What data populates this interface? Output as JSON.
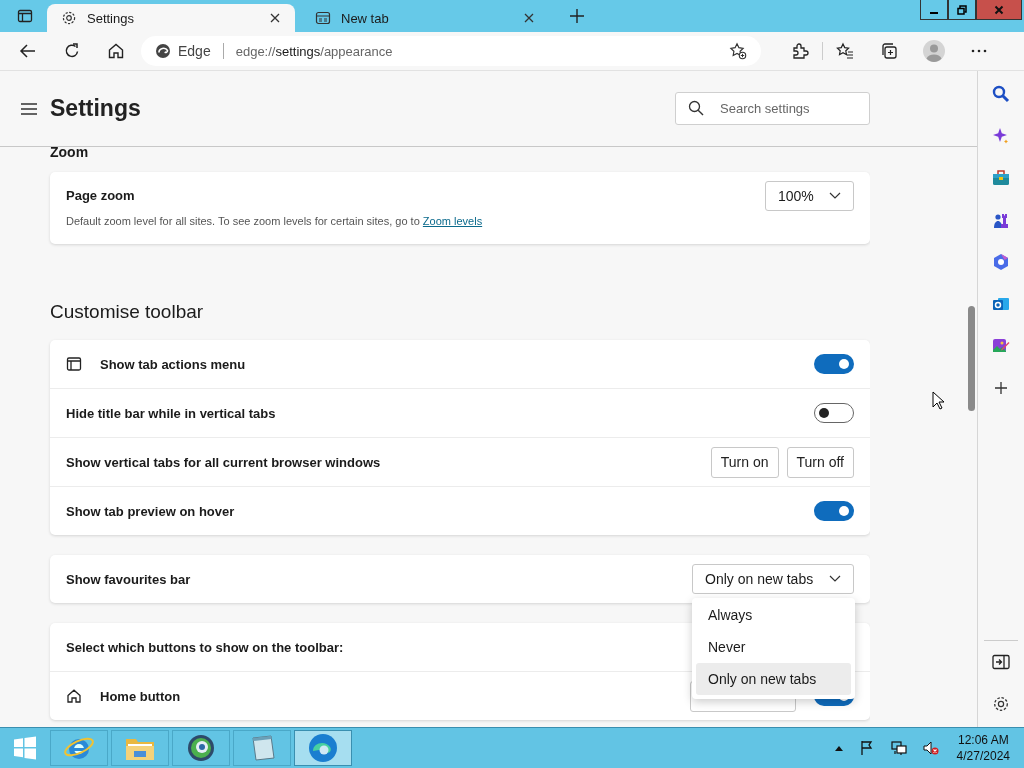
{
  "browser": {
    "tabs": [
      {
        "title": "Settings",
        "selected": true
      },
      {
        "title": "New tab",
        "selected": false
      }
    ],
    "address": {
      "site": "Edge",
      "url": "edge://**settings**/appearance"
    }
  },
  "header": {
    "title": "Settings",
    "search": {
      "placeholder": "Search settings"
    }
  },
  "zoom": {
    "heading": "Zoom",
    "title": "Page zoom",
    "description": "Default zoom level for all sites. To see zoom levels for certain sites, go to",
    "link": "Zoom levels",
    "value": "100%"
  },
  "toolbar": {
    "heading": "Customise toolbar",
    "rows": [
      {
        "kind": "toggle",
        "label": "Show tab actions menu",
        "on": true
      },
      {
        "kind": "toggle",
        "label": "Hide title bar while in vertical tabs",
        "on": false
      },
      {
        "kind": "buttons",
        "label": "Show vertical tabs for all current browser windows",
        "buttons": [
          "Turn on",
          "Turn off"
        ]
      },
      {
        "kind": "toggle",
        "label": "Show tab preview on hover",
        "on": true
      }
    ]
  },
  "favourites_bar": {
    "label": "Show favourites bar",
    "value": "Only on new tabs",
    "expanded": true,
    "options": [
      {
        "label": "Always",
        "selected": false
      },
      {
        "label": "Never",
        "selected": false
      },
      {
        "label": "Only on new tabs",
        "selected": true
      }
    ]
  },
  "toolbar_buttons": {
    "heading": "Select which buttons to show on the toolbar:",
    "rows": [
      {
        "kind": "url-toggle",
        "label": "Home button",
        "on": true
      }
    ]
  },
  "taskbar": {
    "apps": [
      {
        "selected": false
      },
      {
        "selected": false
      },
      {
        "selected": false
      },
      {
        "selected": false
      },
      {
        "selected": true
      }
    ],
    "clock": {
      "time": "12:06 AM",
      "date": "4/27/2024"
    }
  }
}
